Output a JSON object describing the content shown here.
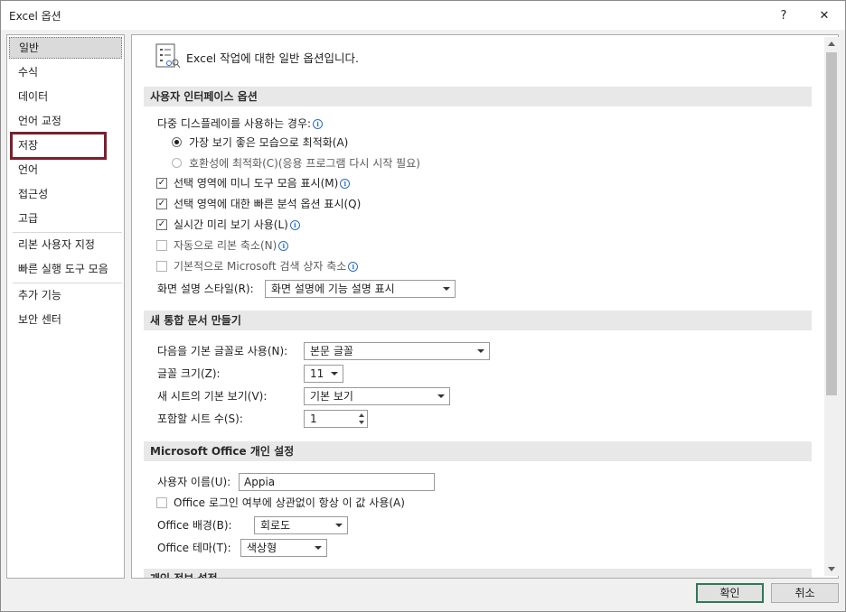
{
  "window": {
    "title": "Excel 옵션",
    "help_label": "?",
    "close_label": "✕"
  },
  "nav": {
    "items": [
      {
        "label": "일반"
      },
      {
        "label": "수식"
      },
      {
        "label": "데이터"
      },
      {
        "label": "언어 교정"
      },
      {
        "label": "저장"
      },
      {
        "label": "언어"
      },
      {
        "label": "접근성"
      },
      {
        "label": "고급"
      },
      {
        "label": "리본 사용자 지정"
      },
      {
        "label": "빠른 실행 도구 모음"
      },
      {
        "label": "추가 기능"
      },
      {
        "label": "보안 센터"
      }
    ],
    "selected_label": "일반",
    "highlighted_label": "저장"
  },
  "header": {
    "text": "Excel 작업에 대한 일반 옵션입니다."
  },
  "ui_section": {
    "title": "사용자 인터페이스 옵션",
    "multi_display_label": "다중 디스플레이를 사용하는 경우:",
    "radio_optimize_appearance": "가장 보기 좋은 모습으로 최적화(A)",
    "radio_optimize_compat": "호환성에 최적화(C)(응용 프로그램 다시 시작 필요)",
    "chk_mini_toolbar": "선택 영역에 미니 도구 모음 표시(M)",
    "chk_quick_analysis": "선택 영역에 대한 빠른 분석 옵션 표시(Q)",
    "chk_live_preview": "실시간 미리 보기 사용(L)",
    "chk_collapse_ribbon": "자동으로 리본 축소(N)",
    "chk_search_collapse": "기본적으로 Microsoft 검색 상자 축소",
    "screentip_label": "화면 설명 스타일(R):",
    "screentip_value": "화면 설명에 기능 설명 표시"
  },
  "workbook_section": {
    "title": "새 통합 문서 만들기",
    "font_label": "다음을 기본 글꼴로 사용(N):",
    "font_value": "본문 글꼴",
    "size_label": "글꼴 크기(Z):",
    "size_value": "11",
    "view_label": "새 시트의 기본 보기(V):",
    "view_value": "기본 보기",
    "sheets_label": "포함할 시트 수(S):",
    "sheets_value": "1"
  },
  "personal_section": {
    "title": "Microsoft Office 개인 설정",
    "username_label": "사용자 이름(U):",
    "username_value": "Appia",
    "always_use_label": "Office 로그인 여부에 상관없이 항상 이 값 사용(A)",
    "background_label": "Office 배경(B):",
    "background_value": "회로도",
    "theme_label": "Office 테마(T):",
    "theme_value": "색상형"
  },
  "privacy_section": {
    "title": "개인 정보 설정"
  },
  "footer": {
    "ok_label": "확인",
    "cancel_label": "취소"
  },
  "colors": {
    "highlight_box": "#7b1f2e",
    "ok_border": "#2d7a57",
    "info_icon": "#2b6cc4"
  }
}
